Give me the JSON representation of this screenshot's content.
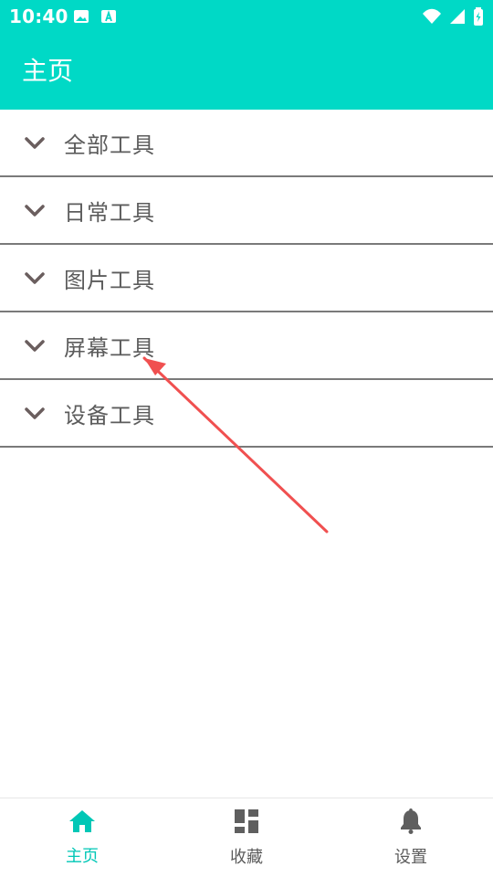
{
  "status_bar": {
    "time": "10:40",
    "icons": [
      "image-icon",
      "text-a-icon",
      "wifi-icon",
      "signal-icon",
      "battery-icon"
    ]
  },
  "app": {
    "title": "主页",
    "accent_color": "#00d9c6",
    "active_color": "#00c7b6"
  },
  "categories": [
    {
      "label": "全部工具",
      "icon": "chevron-down-icon"
    },
    {
      "label": "日常工具",
      "icon": "chevron-down-icon"
    },
    {
      "label": "图片工具",
      "icon": "chevron-down-icon"
    },
    {
      "label": "屏幕工具",
      "icon": "chevron-down-icon"
    },
    {
      "label": "设备工具",
      "icon": "chevron-down-icon"
    }
  ],
  "bottom_nav": {
    "items": [
      {
        "label": "主页",
        "icon": "home-icon",
        "active": true
      },
      {
        "label": "收藏",
        "icon": "dashboard-icon",
        "active": false
      },
      {
        "label": "设置",
        "icon": "bell-icon",
        "active": false
      }
    ]
  }
}
